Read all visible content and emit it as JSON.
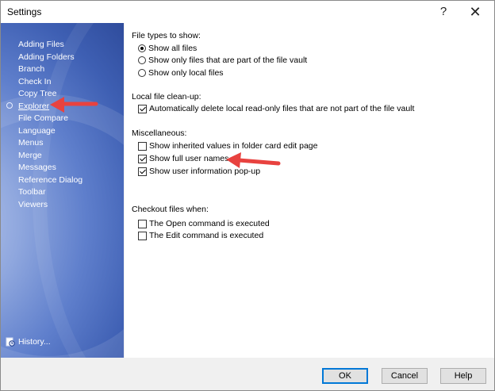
{
  "window": {
    "title": "Settings",
    "help_glyph": "?",
    "close_glyph": "✕"
  },
  "sidebar": {
    "items": [
      {
        "label": "Adding Files"
      },
      {
        "label": "Adding Folders"
      },
      {
        "label": "Branch"
      },
      {
        "label": "Check In"
      },
      {
        "label": "Copy Tree"
      },
      {
        "label": "Explorer"
      },
      {
        "label": "File Compare"
      },
      {
        "label": "Language"
      },
      {
        "label": "Menus"
      },
      {
        "label": "Merge"
      },
      {
        "label": "Messages"
      },
      {
        "label": "Reference Dialog"
      },
      {
        "label": "Toolbar"
      },
      {
        "label": "Viewers"
      }
    ],
    "selected": "Explorer",
    "history_label": "History..."
  },
  "content": {
    "file_types": {
      "label": "File types to show:",
      "options": [
        {
          "label": "Show all files",
          "selected": true
        },
        {
          "label": "Show only files that are part of the file vault",
          "selected": false
        },
        {
          "label": "Show only local files",
          "selected": false
        }
      ]
    },
    "cleanup": {
      "label": "Local file clean-up:",
      "options": [
        {
          "label": "Automatically delete local read-only files that are not part of the file vault",
          "checked": true
        }
      ]
    },
    "misc": {
      "label": "Miscellaneous:",
      "options": [
        {
          "label": "Show inherited values in folder card edit page",
          "checked": false
        },
        {
          "label": "Show full user names",
          "checked": true
        },
        {
          "label": "Show user information pop-up",
          "checked": true
        }
      ]
    },
    "checkout": {
      "label": "Checkout files when:",
      "options": [
        {
          "label": "The Open command is executed",
          "checked": false
        },
        {
          "label": "The Edit command is executed",
          "checked": false
        }
      ]
    }
  },
  "footer": {
    "ok": "OK",
    "cancel": "Cancel",
    "help": "Help"
  },
  "colors": {
    "sidebar": "#4a6cc0",
    "arrow": "#e8423f",
    "default_button_border": "#0078d7"
  }
}
